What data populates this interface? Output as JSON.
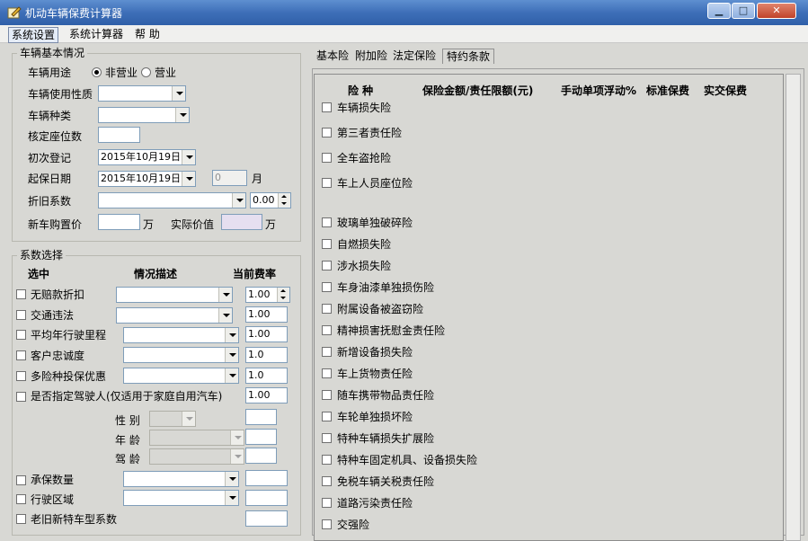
{
  "window": {
    "title": "机动车辆保费计算器",
    "minimize": "▁",
    "maximize": "□",
    "close": "✕"
  },
  "menu": [
    "系统设置",
    "系统计算器",
    "帮  助"
  ],
  "vehicle": {
    "group_title": "车辆基本情况",
    "usage_label": "车辆用途",
    "usage_options": [
      "非营业",
      "营业"
    ],
    "nature_label": "车辆使用性质",
    "type_label": "车辆种类",
    "seats_label": "核定座位数",
    "first_reg_label": "初次登记",
    "first_reg_value": "2015年10月19日",
    "start_label": "起保日期",
    "start_value": "2015年10月19日",
    "months_value": "0",
    "months_unit": "月",
    "depr_label": "折旧系数",
    "depr_value": "0.00",
    "price_label": "新车购置价",
    "price_unit": "万",
    "actual_label": "实际价值",
    "actual_unit": "万"
  },
  "coef": {
    "group_title": "系数选择",
    "col_select": "选中",
    "col_desc": "情况描述",
    "col_rate": "当前费率",
    "rows": [
      {
        "label": "无赔款折扣",
        "value": "1.00"
      },
      {
        "label": "交通违法",
        "value": "1.00"
      },
      {
        "label": "平均年行驶里程",
        "value": "1.00"
      },
      {
        "label": "客户忠诚度",
        "value": "1.0"
      },
      {
        "label": "多险种投保优惠",
        "value": "1.0"
      },
      {
        "label": "是否指定驾驶人(仅适用于家庭自用汽车)",
        "value": "1.00"
      }
    ],
    "gender_label": "性 别",
    "age_label": "年 龄",
    "driving_age_label": "驾 龄",
    "rows2": [
      {
        "label": "承保数量"
      },
      {
        "label": "行驶区域"
      },
      {
        "label": "老旧新特车型系数"
      }
    ]
  },
  "tabs": [
    "基本险",
    "附加险",
    "法定保险",
    "特约条款"
  ],
  "ins_headers": [
    "险  种",
    "保险金额/责任限额(元)",
    "手动单项浮动%",
    "标准保费",
    "实交保费"
  ],
  "insurance": [
    "车辆损失险",
    "第三者责任险",
    "全车盗抢险",
    "车上人员座位险",
    "玻璃单独破碎险",
    "自燃损失险",
    "涉水损失险",
    "车身油漆单独损伤险",
    "附属设备被盗窃险",
    "精神损害抚慰金责任险",
    "新增设备损失险",
    "车上货物责任险",
    "随车携带物品责任险",
    "车轮单独损坏险",
    "特种车辆损失扩展险",
    "特种车固定机具、设备损失险",
    "免税车辆关税责任险",
    "道路污染责任险",
    "交强险"
  ],
  "colors": {
    "titlebar": "#3e6fb8",
    "window_bg": "#d8d8d4",
    "actual_value_bg": "#e6dff0"
  }
}
